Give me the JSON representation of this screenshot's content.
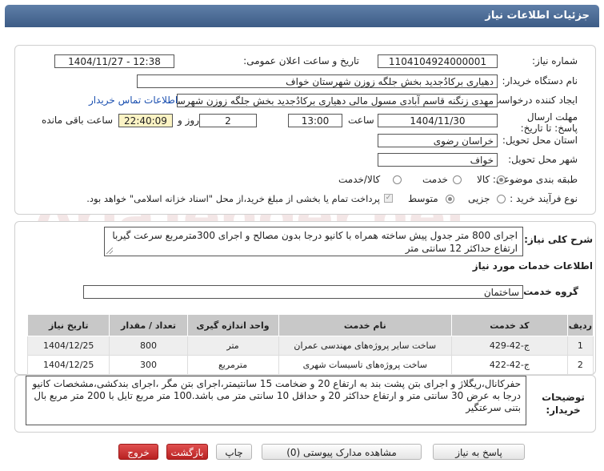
{
  "header": {
    "title": "جزئیات اطلاعات نیاز"
  },
  "watermark": "AriaTender.net",
  "form": {
    "need_number_label": "شماره نیاز:",
    "need_number": "1104104924000001",
    "announce_label": "تاریخ و ساعت اعلان عمومی:",
    "announce_value": "1404/11/27 - 12:38",
    "buyer_org_label": "نام دستگاه خریدار:",
    "buyer_org": "دهیاری برکادُجدید بخش جلگه زوزن شهرستان خواف",
    "creator_label": "ایجاد کننده درخواست:",
    "creator": "مهدی زنگنه قاسم آبادی مسول مالی دهیاری برکادُجدید بخش جلگه زوزن شهرستان خواف",
    "contact_link": "اطلاعات تماس خریدار",
    "deadline_label": "مهلت ارسال پاسخ: تا تاریخ:",
    "deadline_date": "1404/11/30",
    "hour_label": "ساعت",
    "deadline_time": "13:00",
    "days": "2",
    "days_label": "روز و",
    "remaining": "22:40:09",
    "remaining_label": "ساعت باقی مانده",
    "province_label": "استان محل تحویل:",
    "province": "خراسان رضوی",
    "city_label": "شهر محل تحویل:",
    "city": "خواف",
    "category_label": "طبقه بندی موضوعی:",
    "category_options": [
      "کالا",
      "خدمت",
      "کالا/خدمت"
    ],
    "process_label": "نوع فرآیند خرید :",
    "process_options": [
      "جزیی",
      "متوسط"
    ],
    "payment_note": "پرداخت تمام یا بخشی از مبلغ خرید،از محل \"اسناد خزانه اسلامی\" خواهد بود."
  },
  "summary": {
    "label": "شرح کلی نیاز:",
    "text": "اجرای 800 متر جدول پیش ساخته همراه با کانیو درجا بدون مصالح و اجرای 300مترمربع سرعت گیربا ارتفاع حداکثر 12 سانتی متر"
  },
  "services": {
    "section_title": "اطلاعات خدمات مورد نیاز",
    "group_label": "گروه خدمت:",
    "group_value": "ساختمان",
    "columns": [
      "ردیف",
      "کد خدمت",
      "نام خدمت",
      "واحد اندازه گیری",
      "تعداد / مقدار",
      "تاریخ نیاز"
    ],
    "rows": [
      {
        "idx": "1",
        "code": "ج-42-429",
        "name": "ساخت سایر پروژه‌های مهندسی عمران",
        "unit": "متر",
        "qty": "800",
        "date": "1404/12/25"
      },
      {
        "idx": "2",
        "code": "ج-42-422",
        "name": "ساخت پروژه‌های تاسیسات شهری",
        "unit": "مترمربع",
        "qty": "300",
        "date": "1404/12/25"
      }
    ]
  },
  "buyer_notes": {
    "label": "توضیحات خریدار:",
    "text": "حفرکانال،ریگلاژ و اجرای بتن پشت بند به ارتفاع 20  و ضخامت 15 سانتیمتر،اجرای بتن مگر ،اجرای بندکشی،مشخصات کانیو درجا به عرض 30 سانتی متر و ارتفاع حداکثر 20  و حداقل 10 سانتی متر می باشد.100 متر مربع تایل با 200 متر مربع بال بتنی سرعتگیر"
  },
  "buttons": {
    "reply": "پاسخ به نیاز",
    "attachments": "مشاهده مدارک پیوستی (0)",
    "print": "چاپ",
    "back": "بازگشت",
    "exit": "خروج"
  }
}
